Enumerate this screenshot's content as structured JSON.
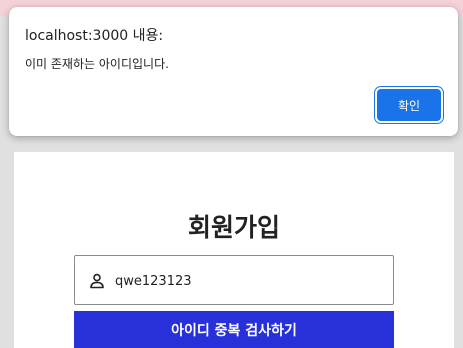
{
  "alert": {
    "origin": "localhost:3000 내용:",
    "message": "이미 존재하는 아이디입니다.",
    "ok_label": "확인"
  },
  "signup": {
    "title": "회원가입",
    "id_value": "qwe123123",
    "dup_check_label": "아이디 중복 검사하기",
    "field_icon": "person-icon"
  },
  "colors": {
    "accent_dialog": "#1a73e8",
    "primary_button": "#2730d9",
    "page_top_strip": "#f4d2d8"
  }
}
